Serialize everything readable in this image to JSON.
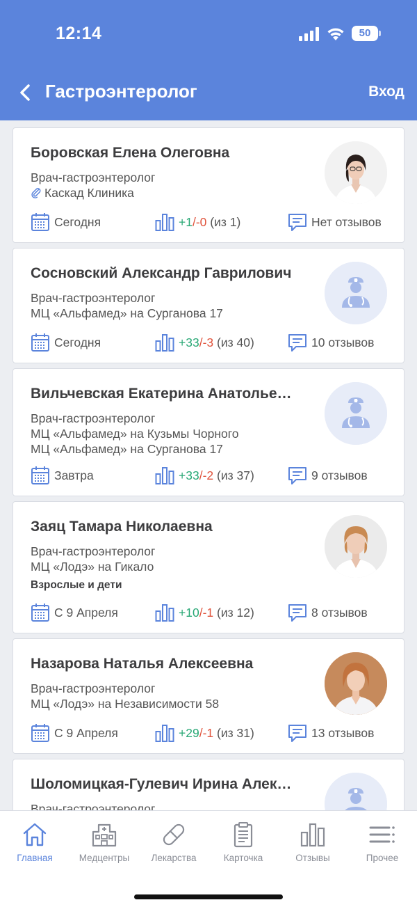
{
  "status_bar": {
    "time": "12:14",
    "battery": "50"
  },
  "header": {
    "title": "Гастроэнтеролог",
    "login": "Вход",
    "back_icon": "chevron-left-icon"
  },
  "colors": {
    "accent": "#5b84dc",
    "positive": "#2aa876",
    "negative": "#e0533c",
    "icon": "#5b84dc"
  },
  "doctors": [
    {
      "name": "Боровская Елена Олеговна",
      "specialty": "Врач-гастроэнтеролог",
      "clinic": "Каскад Клиника",
      "date": "Сегодня",
      "pos": "+1",
      "sep": "/",
      "neg": "-0",
      "of": "(из 1)",
      "reviews": "Нет отзывов"
    },
    {
      "name": "Сосновский Александр Гаврилович",
      "specialty": "Врач-гастроэнтеролог",
      "clinic": "МЦ «Альфамед» на Сурганова 17",
      "date": "Сегодня",
      "pos": "+33",
      "sep": "/",
      "neg": "-3",
      "of": "(из 40)",
      "reviews": "10 отзывов"
    },
    {
      "name": "Вильчевская Екатерина Анатолье…",
      "specialty": "Врач-гастроэнтеролог",
      "clinic": "МЦ «Альфамед» на Кузьмы Чорного",
      "clinic2": "МЦ «Альфамед» на Сурганова 17",
      "date": "Завтра",
      "pos": "+33",
      "sep": "/",
      "neg": "-2",
      "of": "(из 37)",
      "reviews": "9 отзывов"
    },
    {
      "name": "Заяц Тамара Николаевна",
      "specialty": "Врач-гастроэнтеролог",
      "clinic": "МЦ «Лодэ» на Гикало",
      "note": "Взрослые и дети",
      "date": "С 9 Апреля",
      "pos": "+10",
      "sep": "/",
      "neg": "-1",
      "of": "(из 12)",
      "reviews": "8 отзывов"
    },
    {
      "name": "Назарова Наталья Алексеевна",
      "specialty": "Врач-гастроэнтеролог",
      "clinic": "МЦ «Лодэ» на Независимости 58",
      "date": "С 9 Апреля",
      "pos": "+29",
      "sep": "/",
      "neg": "-1",
      "of": "(из 31)",
      "reviews": "13 отзывов"
    },
    {
      "name": "Шоломицкая-Гулевич Ирина Алек…",
      "specialty": "Врач-гастроэнтеролог"
    }
  ],
  "tabs": [
    {
      "label": "Главная",
      "icon": "home-icon"
    },
    {
      "label": "Медцентры",
      "icon": "hospital-icon"
    },
    {
      "label": "Лекарства",
      "icon": "pill-icon"
    },
    {
      "label": "Карточка",
      "icon": "clipboard-icon"
    },
    {
      "label": "Отзывы",
      "icon": "bar-chart-icon"
    },
    {
      "label": "Прочее",
      "icon": "menu-icon"
    }
  ]
}
